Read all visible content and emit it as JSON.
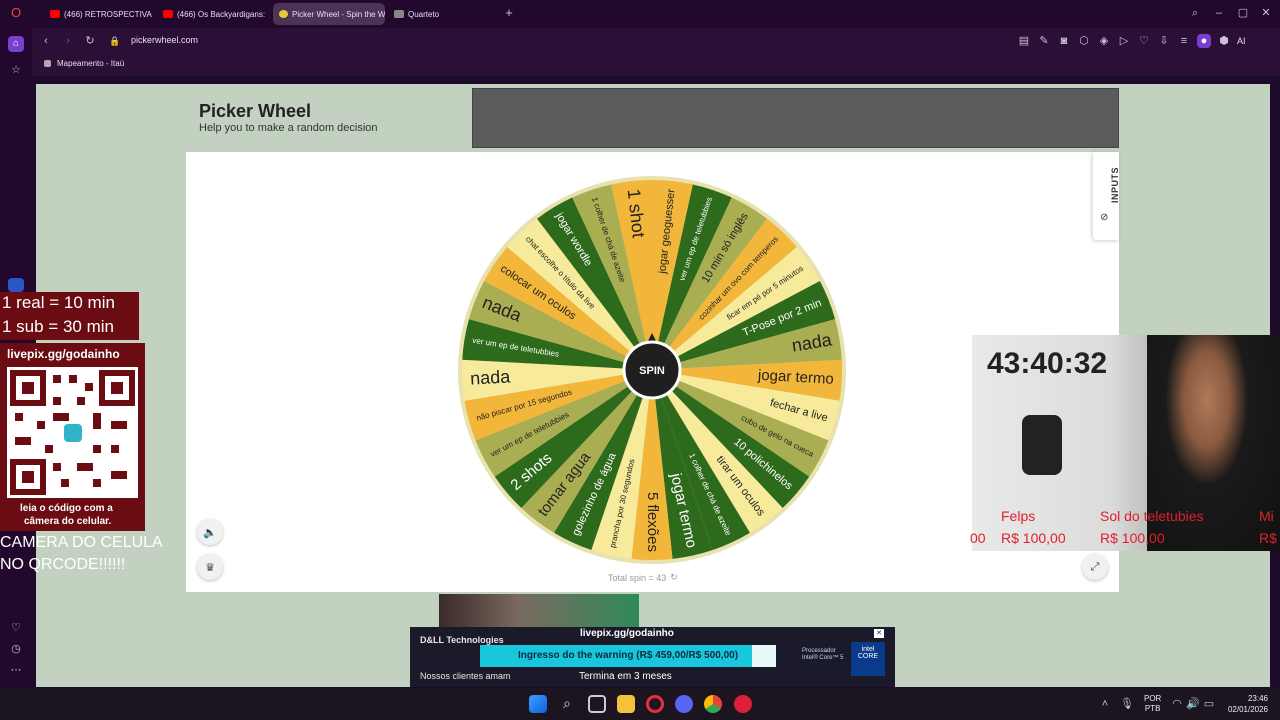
{
  "browser": {
    "tabs": [
      {
        "label": "(466) RETROSPECTIVA 202",
        "favicon": "youtube-icon"
      },
      {
        "label": "(466) Os Backyardigans: O",
        "favicon": "youtube-icon"
      },
      {
        "label": "Picker Wheel - Spin the W",
        "favicon": "pickerwheel-icon",
        "active": true
      },
      {
        "label": "Quarteto",
        "favicon": "t-icon"
      }
    ],
    "url": "pickerwheel.com",
    "bookmark": "Mapeamento - Itaú",
    "ai_label": "AI"
  },
  "page": {
    "title": "Picker Wheel",
    "subtitle": "Help you to make a random decision",
    "inputs_tab": "INPUTS",
    "spin_label": "SPIN",
    "total_spin": "Total spin = 43"
  },
  "wheel": {
    "segments": [
      {
        "label": "jogar geoguesser",
        "color": "#f2b63a"
      },
      {
        "label": "ver um ep de teletubbies",
        "color": "#2e6a1c"
      },
      {
        "label": "10 min só inglês",
        "color": "#a9ae52"
      },
      {
        "label": "cozinhar um ovo com temperos",
        "color": "#f2b63a"
      },
      {
        "label": "ficar em pé por 5 minutos",
        "color": "#f7ea9a"
      },
      {
        "label": "T-Pose por 2 min",
        "color": "#2e6a1c"
      },
      {
        "label": "nada",
        "color": "#a9ae52"
      },
      {
        "label": "jogar termo",
        "color": "#f2b63a"
      },
      {
        "label": "fechar a live",
        "color": "#f7ea9a"
      },
      {
        "label": "cubo de gelo na cueca",
        "color": "#a9ae52"
      },
      {
        "label": "10 polichinelos",
        "color": "#2e6a1c"
      },
      {
        "label": "tirar um oculos",
        "color": "#f7ea9a"
      },
      {
        "label": "1 colher de chá de azeite",
        "color": "#2e6a1c"
      },
      {
        "label": "jogar termo",
        "color": "#2e6a1c"
      },
      {
        "label": "5 flexões",
        "color": "#f2b63a"
      },
      {
        "label": "prancha por 30 segundos",
        "color": "#f7ea9a"
      },
      {
        "label": "golezinho de água",
        "color": "#2e6a1c"
      },
      {
        "label": "tomar agua",
        "color": "#a9ae52"
      },
      {
        "label": "2 shots",
        "color": "#2e6a1c"
      },
      {
        "label": "ver um ep de teletubbies",
        "color": "#a9ae52"
      },
      {
        "label": "não piscar por 15 segundos",
        "color": "#f2b63a"
      },
      {
        "label": "nada",
        "color": "#f7ea9a"
      },
      {
        "label": "ver um ep de teletubbies",
        "color": "#2e6a1c"
      },
      {
        "label": "nada",
        "color": "#a9ae52"
      },
      {
        "label": "colocar um oculos",
        "color": "#f2b63a"
      },
      {
        "label": "chat escolhe o título da live",
        "color": "#f7ea9a"
      },
      {
        "label": "jogar wordle",
        "color": "#2e6a1c"
      },
      {
        "label": "1 colher de chá de azeite",
        "color": "#a9ae52"
      },
      {
        "label": "1 shot",
        "color": "#f2b63a"
      }
    ]
  },
  "overlay": {
    "line1": "1 real = 10 min",
    "line2": "1 sub = 30 min",
    "qr_url": "livepix.gg/godainho",
    "qr_caption_1": "leia o código com a",
    "qr_caption_2": "câmera do celular.",
    "camera_line1": "CAMERA DO CELULA",
    "camera_line2": "NO QRCODE!!!!!!",
    "timer": "43:40:32",
    "donors": [
      {
        "name": "Felps",
        "amount": "R$ 100,00"
      },
      {
        "name": "Sol do teletubies",
        "amount": "R$ 100,00"
      }
    ],
    "donor_partial_left": "00",
    "donor_partial_right_name": "Mi",
    "donor_partial_right_amount": "R$"
  },
  "ad": {
    "brand": "D&LL Technologies",
    "tagline": "Nossos clientes amam",
    "goal_url": "livepix.gg/godainho",
    "goal": "Ingresso do the warning (R$ 459,00/R$ 500,00)",
    "goal_progress": 0.918,
    "goal_end": "Termina em 3 meses",
    "chip_text": "Processador Intel® Core™ 5",
    "chip_logo": "intel CORE"
  },
  "taskbar": {
    "lang": "POR",
    "layout": "PTB",
    "time": "23:46",
    "date": "02/01/2026"
  },
  "colors": {
    "accent_purple": "#7a3fd0",
    "wheel_green": "#2e6a1c",
    "wheel_olive": "#a9ae52",
    "wheel_orange": "#f2b63a",
    "wheel_cream": "#f7ea9a"
  }
}
